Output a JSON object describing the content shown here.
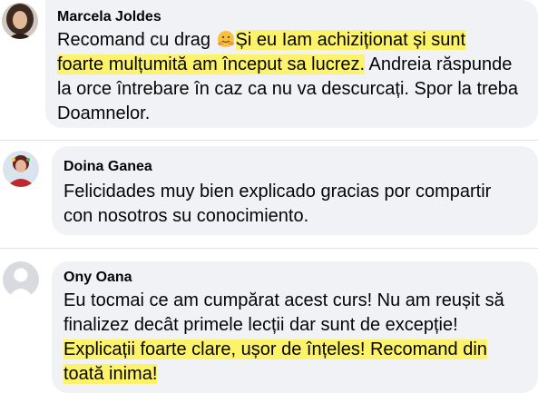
{
  "comments": [
    {
      "author": "Marcela Joldes",
      "lines": [
        {
          "plain": "Recomand cu drag ",
          "emoji": "hugging-face-icon",
          "highlight": "Și eu Iam achiziționat și sunt"
        },
        {
          "highlight": "foarte mulțumită am început sa lucrez.",
          "plain": " Andreia răspunde"
        },
        {
          "plain": "la orce întrebare în caz ca nu va descurcați. Spor la treba"
        },
        {
          "plain": "Doamnelor."
        }
      ]
    },
    {
      "author": "Doina Ganea",
      "lines": [
        {
          "plain": "Felicidades muy bien explicado gracias por compartir"
        },
        {
          "plain": "con nosotros su conocimiento."
        }
      ]
    },
    {
      "author": "Ony Oana",
      "lines": [
        {
          "plain": "Eu tocmai ce am cumpărat acest curs! Nu am reușit să"
        },
        {
          "plain": "finalizez decât primele lecții dar sunt de excepție!"
        },
        {
          "highlight": "Explicații foarte clare, ușor de înțeles! Recomand din"
        },
        {
          "highlight": "toată inima!"
        }
      ]
    }
  ],
  "colors": {
    "bubble": "#f0f2f5",
    "highlight": "#fdf36a",
    "text": "#050505",
    "divider": "#dfe1e5"
  }
}
